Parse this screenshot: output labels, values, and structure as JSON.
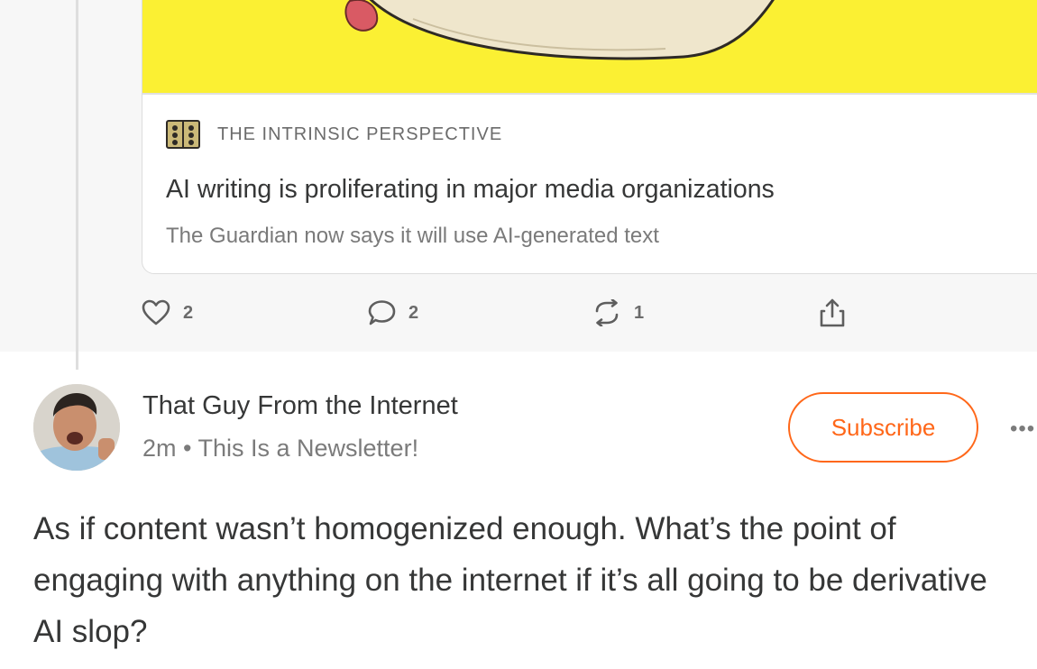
{
  "embed": {
    "publication": "The Intrinsic Perspective",
    "title": "AI writing is proliferating in major media organizations",
    "subtitle": "The Guardian now says it will use AI-generated text"
  },
  "actions": {
    "likes": "2",
    "comments": "2",
    "restacks": "1"
  },
  "post": {
    "author": "That Guy From the Internet",
    "time": "2m",
    "separator": "•",
    "publication": "This Is a Newsletter!",
    "subscribe_label": "Subscribe",
    "more_label": "•••",
    "body": "As if content wasn’t homogenized enough. What’s the point of engaging with anything on the internet if it’s all going to be derivative AI slop?"
  },
  "colors": {
    "accent": "#ff6719",
    "image_background": "#fbf033",
    "text": "#363737",
    "muted": "#7b7b7b"
  },
  "icons": [
    "heart-icon",
    "comment-icon",
    "restack-icon",
    "share-icon",
    "book-logo-icon",
    "more-icon"
  ]
}
